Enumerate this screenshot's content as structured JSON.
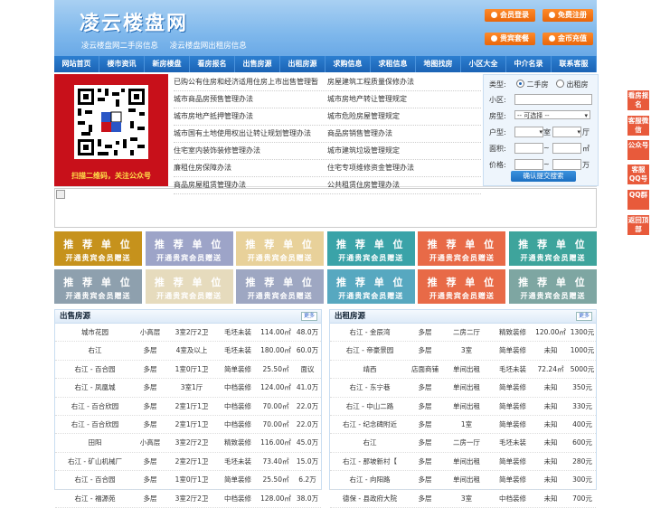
{
  "header": {
    "logo": "凌云楼盘网",
    "sublinks": [
      "凌云楼盘网二手房信息",
      "凌云楼盘网出租房信息"
    ],
    "buttons": [
      "会员登录",
      "免费注册",
      "贵宾套餐",
      "金币充值"
    ]
  },
  "nav": [
    "网站首页",
    "楼市资讯",
    "新房楼盘",
    "看房报名",
    "出售房源",
    "出租房源",
    "求购信息",
    "求租信息",
    "地图找房",
    "小区大全",
    "中介名录",
    "联系客服"
  ],
  "qr": {
    "caption": "扫描二维码，关注公众号"
  },
  "links": [
    [
      "已购公有住房和经济适用住房上市出售管理暂",
      "房屋建筑工程质量保修办法"
    ],
    [
      "城市商品房预售管理办法",
      "城市房地产转让管理规定"
    ],
    [
      "城市房地产抵押管理办法",
      "城市危险房屋管理规定"
    ],
    [
      "城市国有土地使用权出让转让规划管理办法",
      "商品房销售管理办法"
    ],
    [
      "住宅室内装饰装修管理办法",
      "城市建筑垃圾管理规定"
    ],
    [
      "廉租住房保障办法",
      "住宅专项维修资金管理办法"
    ],
    [
      "商品房屋租赁管理办法",
      "公共租赁住房管理办法"
    ]
  ],
  "search": {
    "type_label": "类型:",
    "type_options": [
      "二手房",
      "出租房"
    ],
    "community_label": "小区:",
    "house_type_label": "房型:",
    "house_type_value": "-- 可选择 --",
    "layout_label": "户型:",
    "room_unit": "室",
    "hall_unit": "厅",
    "area_label": "面积:",
    "area_unit": "㎡",
    "price_label": "价格:",
    "price_unit": "万",
    "range_sep": "~",
    "submit": "确认提交搜索"
  },
  "ads": {
    "line1": "推 荐 单 位",
    "line2": "开通贵宾会员赠送",
    "colors": [
      "#c6921c",
      "#9da4c8",
      "#e8d19a",
      "#3aa3a8",
      "#e86a47",
      "#3ea49c",
      "#8ea0ae",
      "#e6dbbd",
      "#9ea7c2",
      "#57a8c0",
      "#e86a47",
      "#7ea6a2"
    ]
  },
  "sale": {
    "title": "出售房源",
    "more": "更多",
    "rows": [
      [
        "城市花园",
        "小高层",
        "3室2厅2卫",
        "毛坯未装",
        "114.00㎡",
        "48.0万"
      ],
      [
        "右江",
        "多层",
        "4室及以上",
        "毛坯未装",
        "180.00㎡",
        "60.0万"
      ],
      [
        "右江 - 百合园",
        "多层",
        "1室0厅1卫",
        "简单装修",
        "25.50㎡",
        "面议"
      ],
      [
        "右江 - 凤凰城",
        "多层",
        "3室1厅",
        "中档装修",
        "124.00㎡",
        "41.0万"
      ],
      [
        "右江 - 百合欣园",
        "多层",
        "2室1厅1卫",
        "中档装修",
        "70.00㎡",
        "22.0万"
      ],
      [
        "右江 - 百合欣园",
        "多层",
        "2室1厅1卫",
        "中档装修",
        "70.00㎡",
        "22.0万"
      ],
      [
        "田阳",
        "小高层",
        "3室2厅2卫",
        "精致装修",
        "116.00㎡",
        "45.0万"
      ],
      [
        "右江 - 矿山机械厂",
        "多层",
        "2室2厅1卫",
        "毛坯未装",
        "73.40㎡",
        "15.0万"
      ],
      [
        "右江 - 百合园",
        "多层",
        "1室0厅1卫",
        "简单装修",
        "25.50㎡",
        "6.2万"
      ],
      [
        "右江 - 福源苑",
        "多层",
        "3室2厅2卫",
        "中档装修",
        "128.00㎡",
        "38.0万"
      ]
    ]
  },
  "rent": {
    "title": "出租房源",
    "more": "更多",
    "rows": [
      [
        "右江 - 金辰湾",
        "多层",
        "二房二厅",
        "精致装修",
        "120.00㎡",
        "1300元"
      ],
      [
        "右江 - 帝豪景园",
        "多层",
        "3室",
        "简单装修",
        "未知",
        "1000元"
      ],
      [
        "靖西",
        "店面商铺",
        "单间出租",
        "毛坯未装",
        "72.24㎡",
        "5000元"
      ],
      [
        "右江 - 东宁巷",
        "多层",
        "单间出租",
        "简单装修",
        "未知",
        "350元"
      ],
      [
        "右江 - 中山二路",
        "多层",
        "单间出租",
        "简单装修",
        "未知",
        "330元"
      ],
      [
        "右江 - 纪念碑附近",
        "多层",
        "1室",
        "简单装修",
        "未知",
        "400元"
      ],
      [
        "右江",
        "多层",
        "二房一厅",
        "毛坯未装",
        "未知",
        "600元"
      ],
      [
        "右江 - 那坡新村【",
        "多层",
        "单间出租",
        "简单装修",
        "未知",
        "280元"
      ],
      [
        "右江 - 向阳路",
        "多层",
        "单间出租",
        "简单装修",
        "未知",
        "300元"
      ],
      [
        "德保 - 县政府大院",
        "多层",
        "3室",
        "中档装修",
        "未知",
        "700元"
      ]
    ]
  },
  "float": [
    "看房报名",
    "客服微信",
    "公众号",
    "客服QQ号",
    "QQ群",
    "返回顶部"
  ]
}
